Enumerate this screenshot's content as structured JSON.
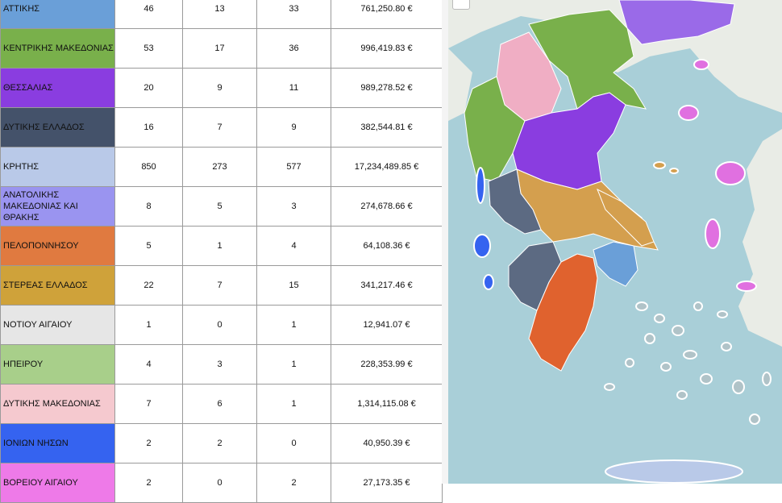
{
  "rows": [
    {
      "region": "ΑΤΤΙΚΗΣ",
      "total": "46",
      "c2": "13",
      "c3": "33",
      "amount": "761,250.80 €",
      "color": "#6a9fd8"
    },
    {
      "region": "ΚΕΝΤΡΙΚΗΣ  ΜΑΚΕΔΟΝΙΑΣ",
      "total": "53",
      "c2": "17",
      "c3": "36",
      "amount": "996,419.83 €",
      "color": "#79b04b"
    },
    {
      "region": "ΘΕΣΣΑΛΙΑΣ",
      "total": "20",
      "c2": "9",
      "c3": "11",
      "amount": "989,278.52 €",
      "color": "#8a3de0"
    },
    {
      "region": "ΔΥΤΙΚΗΣ ΕΛΛΑΔΟΣ",
      "total": "16",
      "c2": "7",
      "c3": "9",
      "amount": "382,544.81 €",
      "color": "#44526a"
    },
    {
      "region": "ΚΡΗΤΗΣ",
      "total": "850",
      "c2": "273",
      "c3": "577",
      "amount": "17,234,489.85 €",
      "color": "#b9c9e8"
    },
    {
      "region": "ΑΝΑΤΟΛΙΚΗΣ ΜΑΚΕΔΟΝΙΑΣ ΚΑΙ ΘΡΑΚΗΣ",
      "total": "8",
      "c2": "5",
      "c3": "3",
      "amount": "274,678.66 €",
      "color": "#9a94f0"
    },
    {
      "region": "ΠΕΛΟΠΟΝΝΗΣΟΥ",
      "total": "5",
      "c2": "1",
      "c3": "4",
      "amount": "64,108.36 €",
      "color": "#e07a40"
    },
    {
      "region": "ΣΤΕΡΕΑΣ ΕΛΛΑΔΟΣ",
      "total": "22",
      "c2": "7",
      "c3": "15",
      "amount": "341,217.46 €",
      "color": "#cfa23a"
    },
    {
      "region": "ΝΟΤΙΟΥ ΑΙΓΑΙΟΥ",
      "total": "1",
      "c2": "0",
      "c3": "1",
      "amount": "12,941.07 €",
      "color": "#e6e6e6"
    },
    {
      "region": "ΗΠΕΙΡΟΥ",
      "total": "4",
      "c2": "3",
      "c3": "1",
      "amount": "228,353.99 €",
      "color": "#a8cf8a"
    },
    {
      "region": "ΔΥΤΙΚΗΣ ΜΑΚΕΔΟΝΙΑΣ",
      "total": "7",
      "c2": "6",
      "c3": "1",
      "amount": "1,314,115.08 €",
      "color": "#f5c9cf"
    },
    {
      "region": "ΙΟΝΙΩΝ ΝΗΣΩΝ",
      "total": "2",
      "c2": "2",
      "c3": "0",
      "amount": "40,950.39 €",
      "color": "#3563f0"
    },
    {
      "region": "ΒΟΡΕΙΟΥ ΑΙΓΑΙΟΥ",
      "total": "2",
      "c2": "0",
      "c3": "2",
      "amount": "27,173.35 €",
      "color": "#ee7ae8"
    }
  ],
  "map": {
    "zoom_label": "−",
    "colors": {
      "sea": "#a9cfd8",
      "land": "#e9ece6",
      "coast": "#eef4f5"
    }
  }
}
